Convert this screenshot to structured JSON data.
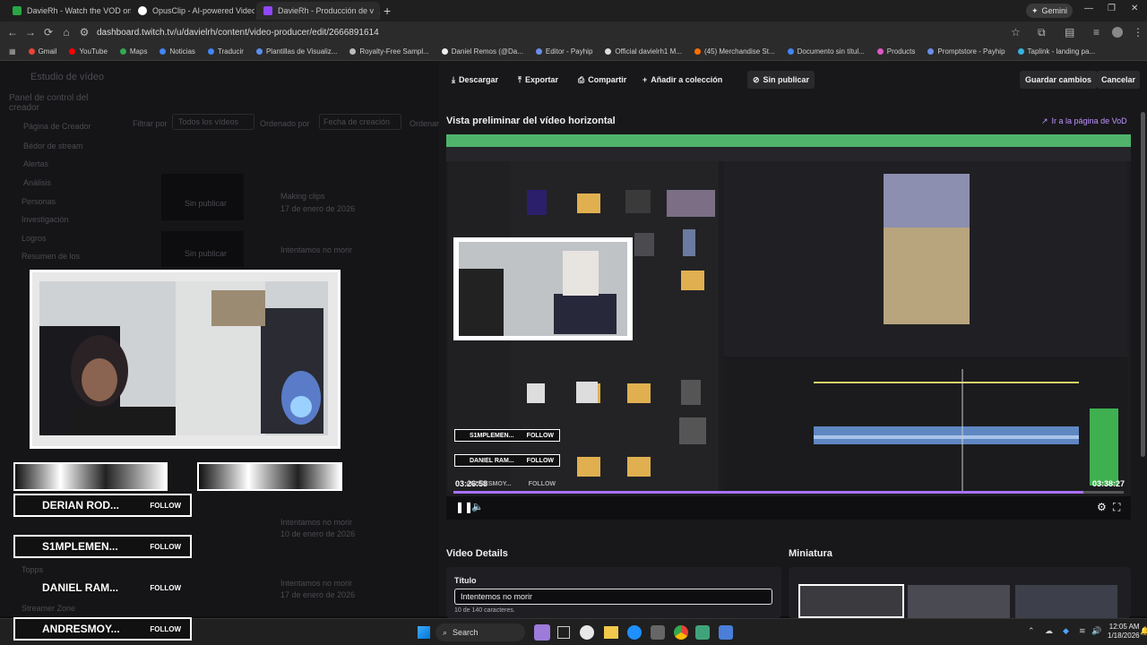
{
  "tabs": [
    {
      "title": "DavieRh - Watch the VOD on I",
      "color": "#28a745"
    },
    {
      "title": "OpusClip - AI-powered Video R",
      "color": "#ffffff"
    },
    {
      "title": "DavieRh - Producción de v",
      "color": "#9146ff"
    }
  ],
  "browser": {
    "gemini": "Gemini",
    "url": "dashboard.twitch.tv/u/davielrh/content/video-producer/edit/2666891614"
  },
  "bookmarks": [
    "Gmail",
    "YouTube",
    "Maps",
    "Noticias",
    "Traducir",
    "Plantillas de Visualiz...",
    "Royalty-Free Sampl...",
    "Daniel Remos (@Da...",
    "Editor - Payhip",
    "Official davielrh1 M...",
    "(45) Merchandise St...",
    "Documento sin títul...",
    "Products",
    "Promptstore - Payhip",
    "Taplink - landing pa..."
  ],
  "left_bg": {
    "studio": "Estudio de vídeo",
    "panel": "Panel de control del creador",
    "items": [
      "Página de Creador",
      "Bédor de stream",
      "Alertas",
      "Análisis",
      "Personas",
      "Investigación",
      "Logros",
      "Resumen de los"
    ],
    "filter_label": "Filtrar por",
    "filter_value": "Todos los vídeos",
    "order_label": "Ordenado por",
    "order_value": "Fecha de creación",
    "order_label2": "Ordenar",
    "card1_unpub": "Sin publicar",
    "card1_title": "Making clips",
    "card1_date": "17 de enero de 2026",
    "card2_unpub": "Sin publicar",
    "card2_title": "Intentamos no morir",
    "row_titles": [
      "Intentamos no morir",
      "Intentamos no morir"
    ],
    "row_dates": [
      "10 de enero de 2026",
      "17 de enero de 2026"
    ],
    "bottom": [
      "Topps",
      "Streamer Zone"
    ]
  },
  "toolbar": {
    "download": "Descargar",
    "export": "Exportar",
    "share": "Compartir",
    "add_collection": "Añadir a colección",
    "unpublished": "Sin publicar",
    "save": "Guardar cambios",
    "cancel": "Cancelar"
  },
  "preview": {
    "heading": "Vista preliminar del vídeo horizontal",
    "vod_link": "Ir a la página de VoD",
    "time_current": "03:26:58",
    "time_total": "03:38:27",
    "progress": 0.94
  },
  "details": {
    "heading": "Video Details",
    "title_label": "Título",
    "title_value": "Intentemos no morir",
    "char_count": "10 de 140 caracteres.",
    "thumb_heading": "Miniatura"
  },
  "overlay": {
    "alerts": [
      {
        "name": "DERIAN ROD...",
        "follow": "FOLLOW"
      },
      {
        "name": "S1MPLEMEN...",
        "follow": "FOLLOW"
      },
      {
        "name": "DANIEL RAM...",
        "follow": "FOLLOW"
      },
      {
        "name": "ANDRESMOY...",
        "follow": "FOLLOW"
      }
    ]
  },
  "inner_overlay": {
    "alerts": [
      {
        "name": "S1MPLEMEN...",
        "follow": "FOLLOW"
      },
      {
        "name": "DANIEL RAM...",
        "follow": "FOLLOW"
      },
      {
        "name": "ANDRESMOY...",
        "follow": "FOLLOW"
      }
    ]
  },
  "taskbar": {
    "search": "Search",
    "time": "12:05 AM",
    "date": "1/18/2026"
  }
}
